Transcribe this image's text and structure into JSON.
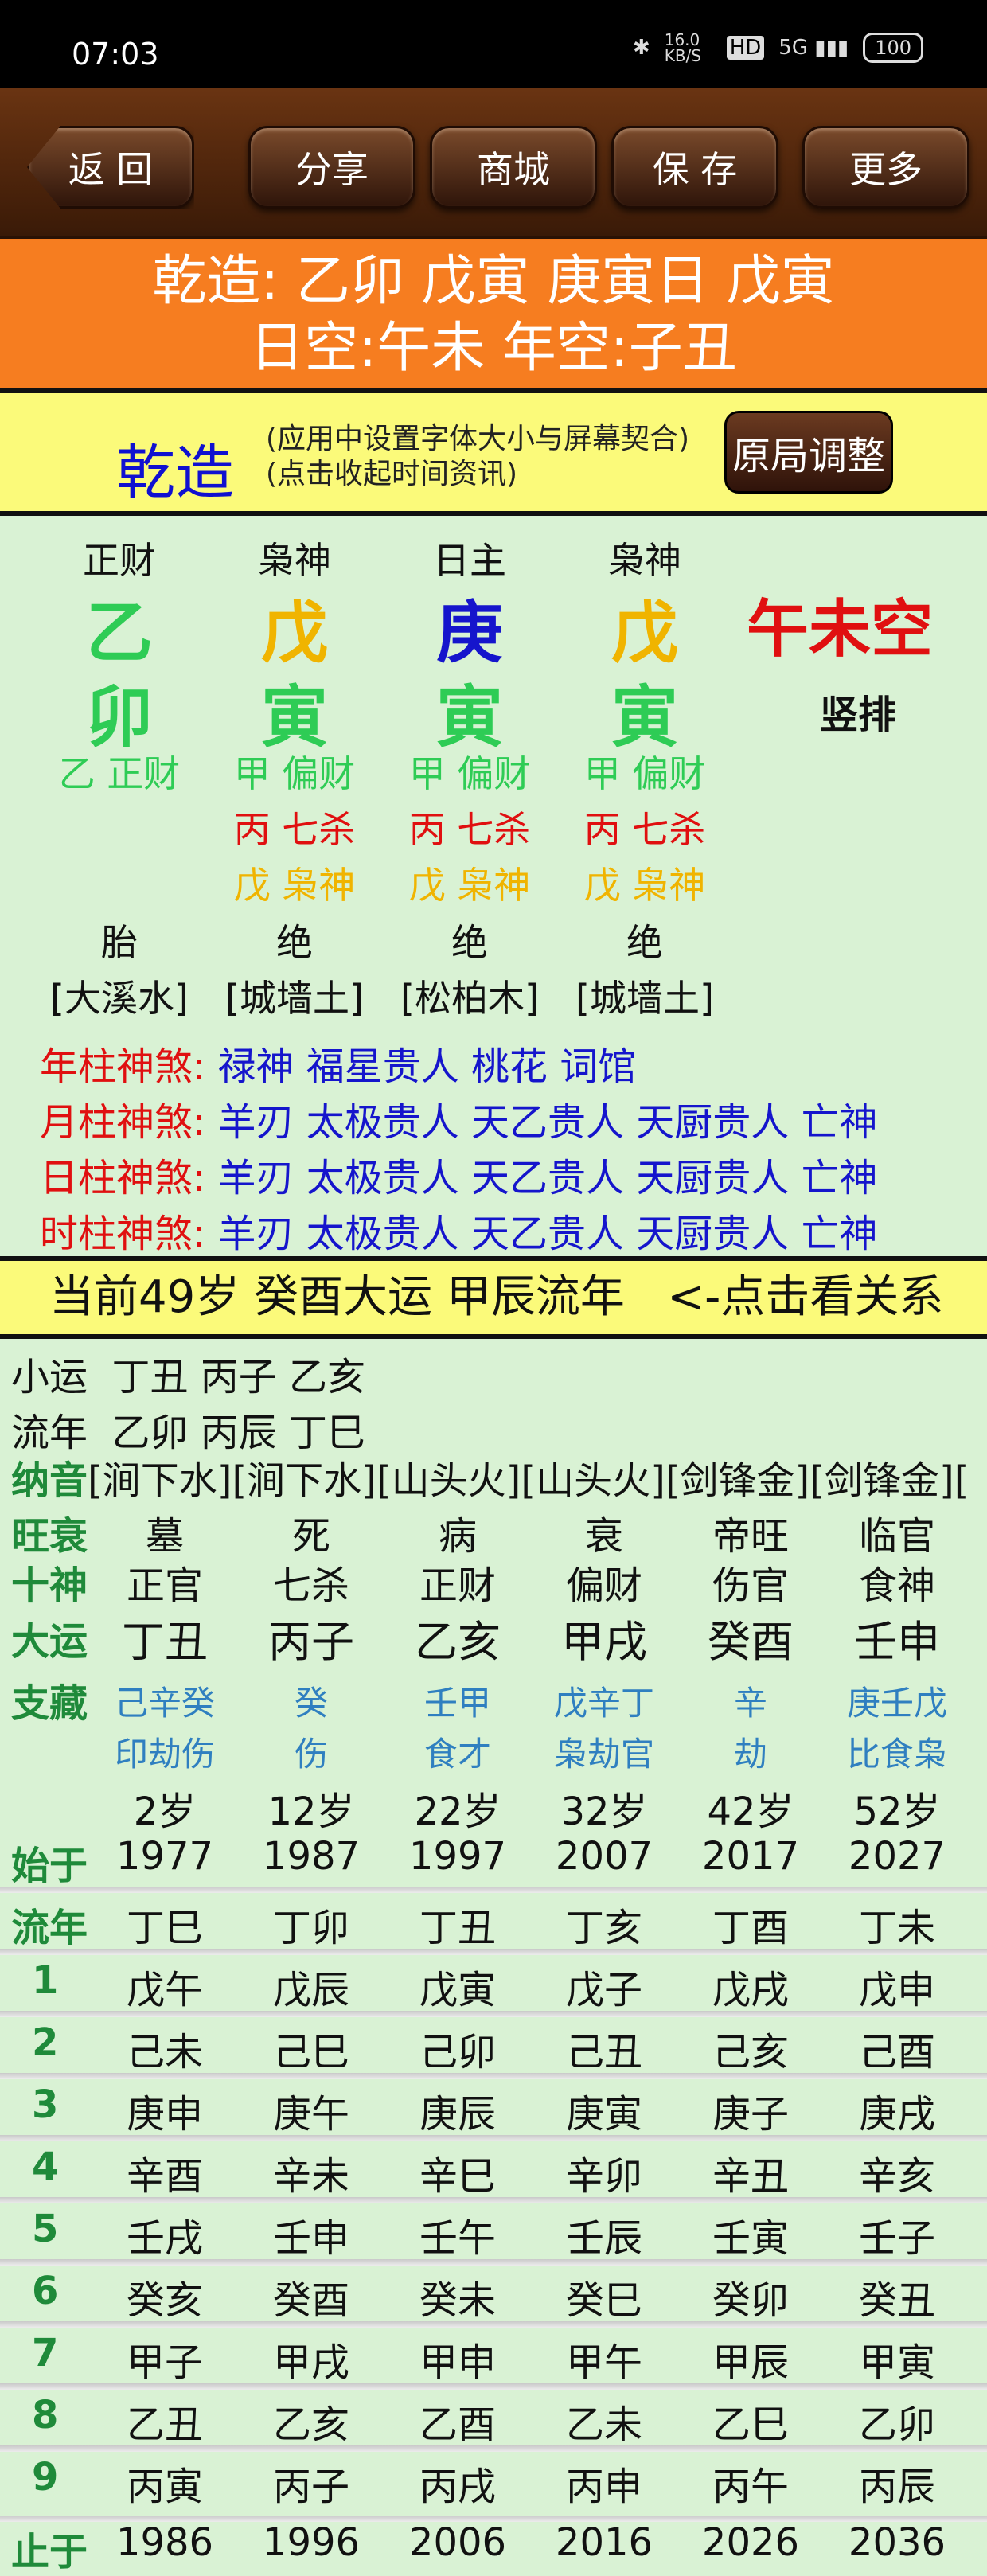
{
  "status_bar": {
    "time": "07:03",
    "net_speed": "16.0 KB/S",
    "hd": "HD",
    "signal": "5G",
    "battery": "100"
  },
  "toolbar": {
    "back": "返 回",
    "share": "分享",
    "mall": "商城",
    "save": "保 存",
    "more": "更多"
  },
  "banner": {
    "line1": "乾造: 乙卯 戊寅 庚寅日 戊寅",
    "line2": "日空:午未 年空:子丑"
  },
  "chart_header": {
    "title": "乾造",
    "hint1": "(应用中设置字体大小与屏幕契合)",
    "hint2": "(点击收起时间资讯)",
    "adjust_button": "原局调整"
  },
  "pillars": [
    {
      "god": "正财",
      "stem": "乙",
      "branch": "卯",
      "hidden": [
        "乙 正财"
      ],
      "stage": "胎",
      "nayin": "[大溪水]"
    },
    {
      "god": "枭神",
      "stem": "戊",
      "branch": "寅",
      "hidden": [
        "甲 偏财",
        "丙 七杀",
        "戊 枭神"
      ],
      "stage": "绝",
      "nayin": "[城墙土]"
    },
    {
      "god": "日主",
      "stem": "庚",
      "branch": "寅",
      "hidden": [
        "甲 偏财",
        "丙 七杀",
        "戊 枭神"
      ],
      "stage": "绝",
      "nayin": "[松柏木]"
    },
    {
      "god": "枭神",
      "stem": "戊",
      "branch": "寅",
      "hidden": [
        "甲 偏财",
        "丙 七杀",
        "戊 枭神"
      ],
      "stage": "绝",
      "nayin": "[城墙土]"
    }
  ],
  "kong": "午未空",
  "vertical_button": "竖排",
  "colors": {
    "wood": "#2ecc55",
    "earth": "#f0b400",
    "metal": "#1515cc",
    "fire": "#e01010",
    "green_label": "#1f8a3a",
    "banner": "#f67d20",
    "yellow": "#fbfa7a"
  },
  "shensha": [
    {
      "label": "年柱神煞:",
      "value": "禄神 福星贵人 桃花 词馆"
    },
    {
      "label": "月柱神煞:",
      "value": "羊刃 太极贵人 天乙贵人 天厨贵人 亡神"
    },
    {
      "label": "日柱神煞:",
      "value": "羊刃 太极贵人 天乙贵人 天厨贵人 亡神"
    },
    {
      "label": "时柱神煞:",
      "value": "羊刃 太极贵人 天乙贵人 天厨贵人 亡神"
    }
  ],
  "current": "当前49岁 癸酉大运 甲辰流年   <-点击看关系",
  "xiaoyun": "小运  丁丑 丙子 乙亥",
  "liunian": "流年  乙卯 丙辰 丁巳",
  "nayin_row": {
    "label": "纳音",
    "values": "[涧下水][涧下水][山头火][山头火][剑锋金][剑锋金]["
  },
  "labels": {
    "wangshuai": "旺衰",
    "shishen": "十神",
    "dayun": "大运",
    "zhicang": "支藏",
    "shiyu": "始于",
    "liunian": "流年",
    "zhiyu": "止于"
  },
  "wangshuai": [
    "墓",
    "死",
    "病",
    "衰",
    "帝旺",
    "临官"
  ],
  "shishen": [
    "正官",
    "七杀",
    "正财",
    "偏财",
    "伤官",
    "食神"
  ],
  "dayun": [
    "丁丑",
    "丙子",
    "乙亥",
    "甲戌",
    "癸酉",
    "壬申"
  ],
  "zhicang_stems": [
    "己辛癸",
    "癸",
    "壬甲",
    "戊辛丁",
    "辛",
    "庚壬戊"
  ],
  "zhicang_gods": [
    "印劫伤",
    "伤",
    "食才",
    "枭劫官",
    "劫",
    "比食枭"
  ],
  "ages": [
    "2岁",
    "12岁",
    "22岁",
    "32岁",
    "42岁",
    "52岁"
  ],
  "start_years": [
    "1977",
    "1987",
    "1997",
    "2007",
    "2017",
    "2027"
  ],
  "liunian_header": [
    "丁巳",
    "丁卯",
    "丁丑",
    "丁亥",
    "丁酉",
    "丁未"
  ],
  "year_rows": [
    {
      "n": "1",
      "cells": [
        "戊午",
        "戊辰",
        "戊寅",
        "戊子",
        "戊戌",
        "戊申"
      ]
    },
    {
      "n": "2",
      "cells": [
        "己未",
        "己巳",
        "己卯",
        "己丑",
        "己亥",
        "己酉"
      ]
    },
    {
      "n": "3",
      "cells": [
        "庚申",
        "庚午",
        "庚辰",
        "庚寅",
        "庚子",
        "庚戌"
      ]
    },
    {
      "n": "4",
      "cells": [
        "辛酉",
        "辛未",
        "辛巳",
        "辛卯",
        "辛丑",
        "辛亥"
      ]
    },
    {
      "n": "5",
      "cells": [
        "壬戌",
        "壬申",
        "壬午",
        "壬辰",
        "壬寅",
        "壬子"
      ]
    },
    {
      "n": "6",
      "cells": [
        "癸亥",
        "癸酉",
        "癸未",
        "癸巳",
        "癸卯",
        "癸丑"
      ]
    },
    {
      "n": "7",
      "cells": [
        "甲子",
        "甲戌",
        "甲申",
        "甲午",
        "甲辰",
        "甲寅"
      ]
    },
    {
      "n": "8",
      "cells": [
        "乙丑",
        "乙亥",
        "乙酉",
        "乙未",
        "乙巳",
        "乙卯"
      ]
    },
    {
      "n": "9",
      "cells": [
        "丙寅",
        "丙子",
        "丙戌",
        "丙申",
        "丙午",
        "丙辰"
      ]
    }
  ],
  "end_years": [
    "1986",
    "1996",
    "2006",
    "2016",
    "2026",
    "2036"
  ]
}
